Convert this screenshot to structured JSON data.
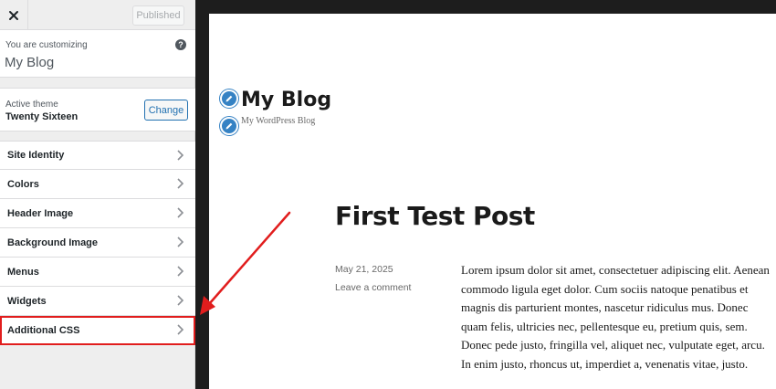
{
  "header": {
    "publish_label": "Published"
  },
  "info": {
    "label": "You are customizing",
    "title": "My Blog"
  },
  "theme": {
    "label": "Active theme",
    "name": "Twenty Sixteen",
    "change_label": "Change"
  },
  "menu": {
    "items": [
      {
        "label": "Site Identity"
      },
      {
        "label": "Colors"
      },
      {
        "label": "Header Image"
      },
      {
        "label": "Background Image"
      },
      {
        "label": "Menus"
      },
      {
        "label": "Widgets"
      },
      {
        "label": "Additional CSS"
      }
    ]
  },
  "preview": {
    "site_title": "My Blog",
    "site_description": "My WordPress Blog",
    "post": {
      "title": "First Test Post",
      "date": "May 21, 2025",
      "comment_link": "Leave a comment",
      "body": "Lorem ipsum dolor sit amet, consectetuer adipiscing elit. Aenean commodo ligula eget dolor. Cum sociis natoque penatibus et magnis dis parturient montes, nascetur ridiculus mus. Donec quam felis, ultricies nec, pellentesque eu, pretium quis, sem. Donec pede justo, fringilla vel, aliquet nec, vulputate eget, arcu. In enim justo, rhoncus ut, imperdiet a, venenatis vitae, justo."
    }
  },
  "colors": {
    "accent": "#2271b1",
    "highlight": "#e11d1d",
    "pencil": "#3582c4"
  },
  "icons": [
    "close-icon",
    "help-icon",
    "chevron-right-icon",
    "edit-pencil-icon",
    "annotation-arrow"
  ]
}
